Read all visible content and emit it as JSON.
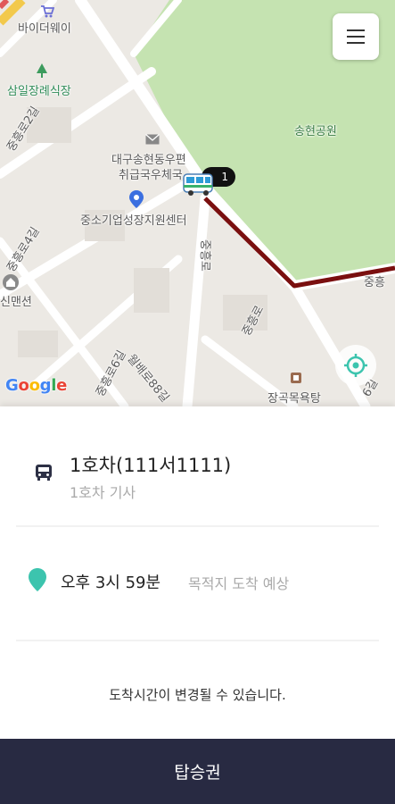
{
  "map": {
    "labels": {
      "poi_mart": "바이더웨이",
      "poi_restaurant": "삼일장례식장",
      "street_a": "중흥로2길",
      "street_b": "중흥로4길",
      "poi_pension": "신맨션",
      "poi_post": "대구송현동우편",
      "poi_post_2": "취급국우체국",
      "poi_center": "중소기업성장지원센터",
      "park": "송현공원",
      "street_vertical": "중흥로",
      "street_c": "중흥로6길",
      "street_d": "월배로88길",
      "street_right": "중흥",
      "poi_bottom": "장곡목욕탕",
      "street_bottom_right": "6길",
      "street_mid": "중흥로",
      "bus_tag": "1"
    },
    "google_logo": "Google",
    "route_color": "#7a0f0f",
    "park_color": "#c5e3b1"
  },
  "menu_button": {
    "icon": "hamburger-icon"
  },
  "locate_button": {
    "icon": "crosshair-icon"
  },
  "vehicle": {
    "title": "1호차(111서1111)",
    "driver": "1호차 기사",
    "icon": "bus-icon"
  },
  "eta": {
    "time": "오후 3시 59분",
    "label": "목적지 도착 예상",
    "icon": "location-pin-icon",
    "accent": "#3cc4ae"
  },
  "notice": "도착시간이 변경될 수 있습니다.",
  "footer": {
    "label": "탑승권",
    "background": "#282a42"
  }
}
